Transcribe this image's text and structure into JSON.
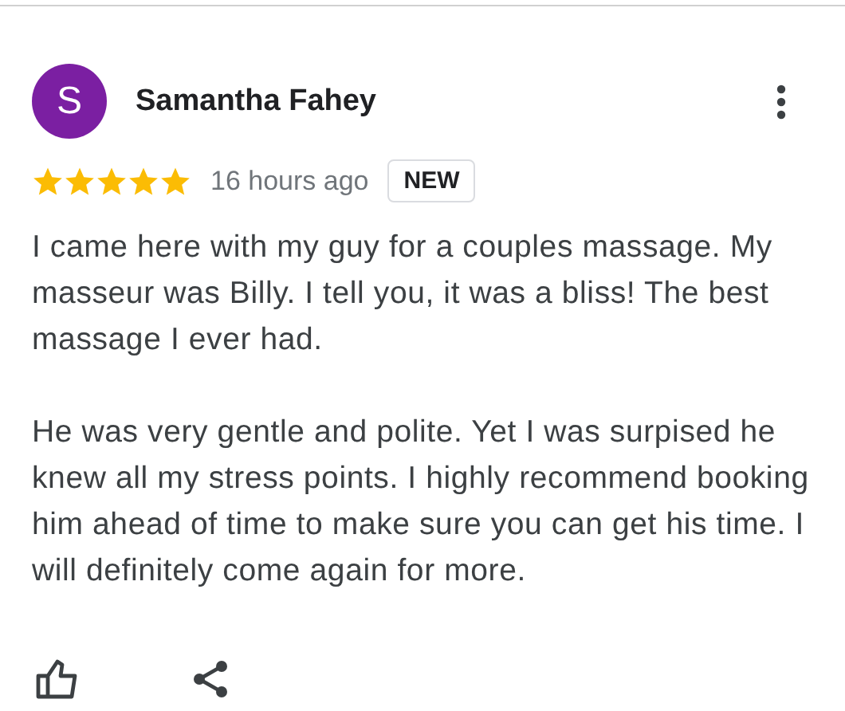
{
  "review": {
    "avatar_letter": "S",
    "author": "Samantha Fahey",
    "stars": 5,
    "time": "16 hours ago",
    "badge": "NEW",
    "paragraphs": [
      "I came here with my guy for a couples massage. My masseur was Billy. I tell you, it was a bliss! The best massage I ever had.",
      "He was very gentle and polite. Yet I was surpised he knew all my stress points. I highly recommend booking him ahead of time to make sure you can get his time. I will definitely come again for more."
    ]
  }
}
